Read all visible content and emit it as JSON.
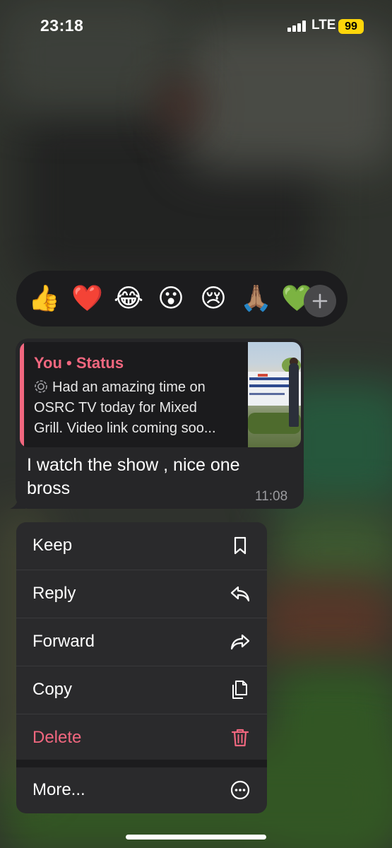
{
  "status_bar": {
    "time": "23:18",
    "network": "LTE",
    "battery": "99"
  },
  "reactions": {
    "items": [
      "👍",
      "❤️",
      "😂",
      "😮",
      "😢",
      "🙏🏽",
      "💚"
    ],
    "add_icon": "plus-icon"
  },
  "message": {
    "quote_author": "You • Status",
    "quote_lines": [
      "Had an amazing time on",
      "OSRC TV today for Mixed",
      "Grill. Video link coming soo..."
    ],
    "text": "I watch the show , nice one bross",
    "time": "11:08"
  },
  "menu": {
    "items": [
      {
        "label": "Keep",
        "icon": "bookmark-icon"
      },
      {
        "label": "Reply",
        "icon": "reply-icon"
      },
      {
        "label": "Forward",
        "icon": "forward-icon"
      },
      {
        "label": "Copy",
        "icon": "copy-icon"
      },
      {
        "label": "Delete",
        "icon": "trash-icon"
      }
    ],
    "more": {
      "label": "More...",
      "icon": "ellipsis-circle-icon"
    }
  },
  "colors": {
    "accent": "#f1677f",
    "battery": "#ffd60a",
    "menu_bg": "#2a2a2c"
  }
}
